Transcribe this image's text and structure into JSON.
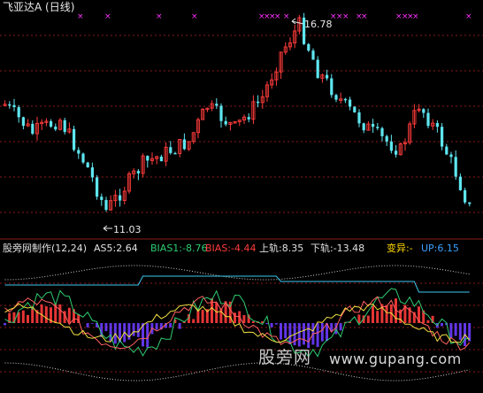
{
  "header": {
    "title": "飞亚达A (日线)"
  },
  "price_panel": {
    "high_label": "16.78",
    "low_label": "11.03"
  },
  "indicator_panel": {
    "name": "股旁网制作(12,24)",
    "as5": "AS5:2.64",
    "bias1": "BIAS1:-8.76",
    "bias": "BIAS:-4.44",
    "upper_rail": "上轨:8.35",
    "lower_rail": "下轨:-13.48",
    "change": "变异:-",
    "up": "UP:6.15"
  },
  "watermark": {
    "site_cn": "股旁网",
    "site_url": "www.gupang.com"
  },
  "colors": {
    "background": "#000000",
    "candle_up": "#ff3b3b",
    "candle_down": "#5ee6f0",
    "signal_marker": "#ff33ff",
    "grid": "#8b1a1a",
    "bias1": "#2ecc71",
    "bias": "#ff3b3b",
    "change": "#ffd700",
    "up": "#3aa0ff"
  }
}
